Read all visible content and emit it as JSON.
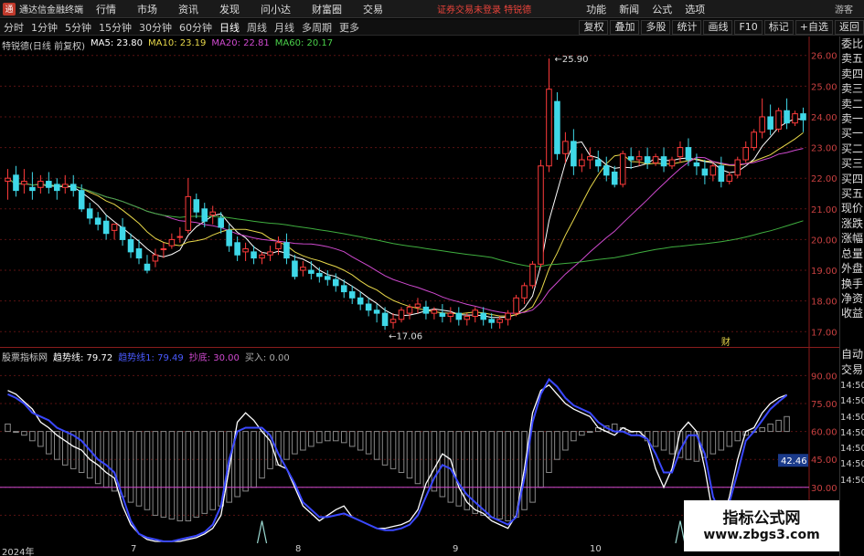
{
  "titlebar": {
    "app_title": "通达信金融终端",
    "menu": [
      "行情",
      "市场",
      "资讯",
      "发现",
      "问小达",
      "财富圈",
      "交易"
    ],
    "notice": "证券交易未登录  特锐德",
    "right_menu": [
      "功能",
      "新闻",
      "公式",
      "选项"
    ],
    "guest": "游客"
  },
  "toolbar": {
    "periods": [
      "分时",
      "1分钟",
      "5分钟",
      "15分钟",
      "30分钟",
      "60分钟",
      "日线",
      "周线",
      "月线",
      "多周期",
      "更多"
    ],
    "active_period": "日线",
    "right_buttons": [
      "复权",
      "叠加",
      "多股",
      "统计",
      "画线",
      "F10",
      "标记",
      "+自选",
      "返回"
    ]
  },
  "main_chart": {
    "stock": "特锐德(日线 前复权)",
    "ma5": "MA5: 23.80",
    "ma10": "MA10: 23.19",
    "ma20": "MA20: 22.81",
    "ma60": "MA60: 20.17",
    "high_label": "25.90",
    "low_label": "17.06",
    "marker_label": "财"
  },
  "indicator": {
    "name": "股票指标网",
    "trend": "趋势线: 79.72",
    "trend2": "趋势线1: 79.49",
    "buy_line": "抄底: 30.00",
    "buy_in": "买入: 0.00",
    "current_value": "42.46",
    "axis_labels": [
      "90.00",
      "75.00",
      "60.00",
      "45.00",
      "30.00",
      "15.00"
    ]
  },
  "x_axis": [
    "2024年",
    "7",
    "8",
    "9",
    "10"
  ],
  "side_panel": [
    "委比",
    "卖五",
    "卖四",
    "卖三",
    "卖二",
    "卖一",
    "买一",
    "买二",
    "买三",
    "买四",
    "买五",
    "现价",
    "涨跌",
    "涨幅",
    "总量",
    "外盘",
    "换手",
    "净资",
    "收益"
  ],
  "side_panel2": [
    "自动",
    "交易"
  ],
  "side_times": [
    "14:50",
    "14:50",
    "14:50",
    "14:50",
    "14:50",
    "14:50",
    "14:50"
  ],
  "watermark": {
    "title": "指标公式网",
    "url": "www.zbgs3.com"
  },
  "chart_data": [
    {
      "type": "line",
      "chart_kind": "candlestick",
      "y_axis_labels": [
        "26.00",
        "25.00",
        "24.00",
        "23.00",
        "22.00",
        "21.00",
        "20.00",
        "19.00",
        "18.00",
        "17.00"
      ],
      "ylim": [
        16.8,
        26.2
      ],
      "x_ticks": [
        "2024年",
        "7",
        "8",
        "9",
        "10"
      ],
      "candles": [
        [
          21.9,
          22.3,
          22.0,
          21.3
        ],
        [
          22.1,
          22.4,
          21.6,
          21.4
        ],
        [
          21.8,
          22.3,
          21.9,
          21.5
        ],
        [
          21.7,
          22.2,
          21.6,
          21.3
        ],
        [
          21.7,
          22.1,
          21.9,
          21.5
        ],
        [
          21.9,
          22.2,
          21.7,
          21.5
        ],
        [
          21.8,
          22.0,
          21.6,
          21.3
        ],
        [
          21.7,
          22.1,
          21.8,
          21.5
        ],
        [
          21.8,
          22.1,
          21.6,
          21.4
        ],
        [
          21.6,
          21.8,
          21.0,
          20.9
        ],
        [
          21.0,
          21.2,
          20.7,
          20.5
        ],
        [
          20.7,
          20.9,
          20.5,
          20.3
        ],
        [
          20.6,
          20.8,
          20.2,
          20.0
        ],
        [
          20.3,
          20.5,
          20.5,
          20.0
        ],
        [
          20.4,
          20.7,
          20.0,
          19.8
        ],
        [
          20.0,
          20.2,
          19.6,
          19.4
        ],
        [
          19.7,
          20.0,
          19.4,
          19.2
        ],
        [
          19.2,
          19.5,
          19.0,
          18.9
        ],
        [
          19.3,
          19.7,
          19.5,
          19.1
        ],
        [
          19.7,
          19.9,
          19.7,
          19.4
        ],
        [
          19.8,
          20.2,
          20.0,
          19.7
        ],
        [
          20.1,
          20.4,
          20.1,
          19.9
        ],
        [
          20.3,
          22.0,
          21.4,
          20.2
        ],
        [
          21.3,
          21.5,
          20.9,
          20.7
        ],
        [
          21.0,
          21.2,
          20.6,
          20.4
        ],
        [
          20.8,
          21.1,
          20.9,
          20.5
        ],
        [
          20.7,
          20.9,
          20.4,
          20.2
        ],
        [
          20.3,
          20.5,
          19.8,
          19.6
        ],
        [
          19.9,
          20.1,
          19.5,
          19.3
        ],
        [
          19.6,
          19.9,
          19.7,
          19.3
        ],
        [
          19.6,
          19.8,
          19.4,
          19.2
        ],
        [
          19.4,
          19.6,
          19.5,
          19.2
        ],
        [
          19.5,
          19.8,
          19.6,
          19.3
        ],
        [
          19.7,
          20.1,
          19.9,
          19.5
        ],
        [
          19.9,
          20.2,
          19.4,
          19.2
        ],
        [
          19.3,
          19.5,
          18.8,
          18.7
        ],
        [
          19.0,
          19.3,
          19.1,
          18.8
        ],
        [
          19.0,
          19.3,
          18.9,
          18.7
        ],
        [
          18.9,
          19.1,
          18.8,
          18.6
        ],
        [
          18.8,
          19.0,
          18.7,
          18.5
        ],
        [
          18.7,
          18.9,
          18.5,
          18.3
        ],
        [
          18.5,
          18.7,
          18.3,
          18.1
        ],
        [
          18.3,
          18.5,
          18.1,
          17.9
        ],
        [
          18.1,
          18.3,
          17.9,
          17.7
        ],
        [
          17.9,
          18.1,
          17.7,
          17.5
        ],
        [
          17.7,
          17.9,
          17.6,
          17.3
        ],
        [
          17.6,
          17.8,
          17.2,
          17.06
        ],
        [
          17.3,
          17.6,
          17.4,
          17.1
        ],
        [
          17.4,
          17.8,
          17.7,
          17.3
        ],
        [
          17.6,
          17.9,
          17.8,
          17.4
        ],
        [
          17.8,
          18.1,
          17.9,
          17.6
        ],
        [
          17.8,
          18.0,
          17.6,
          17.4
        ],
        [
          17.6,
          17.8,
          17.7,
          17.4
        ],
        [
          17.6,
          17.9,
          17.5,
          17.3
        ],
        [
          17.5,
          17.8,
          17.6,
          17.3
        ],
        [
          17.6,
          17.8,
          17.4,
          17.2
        ],
        [
          17.4,
          17.6,
          17.5,
          17.2
        ],
        [
          17.5,
          17.8,
          17.7,
          17.3
        ],
        [
          17.6,
          17.8,
          17.4,
          17.2
        ],
        [
          17.4,
          17.6,
          17.3,
          17.1
        ],
        [
          17.3,
          17.5,
          17.4,
          17.1
        ],
        [
          17.4,
          17.7,
          17.6,
          17.2
        ],
        [
          17.6,
          18.2,
          18.1,
          17.5
        ],
        [
          18.1,
          18.6,
          18.5,
          17.9
        ],
        [
          18.5,
          19.3,
          19.2,
          18.4
        ],
        [
          19.2,
          22.6,
          22.4,
          19.1
        ],
        [
          22.4,
          25.9,
          24.9,
          22.2
        ],
        [
          24.5,
          24.8,
          22.8,
          22.6
        ],
        [
          22.8,
          23.5,
          23.2,
          22.5
        ],
        [
          23.2,
          23.6,
          22.4,
          22.1
        ],
        [
          22.4,
          22.8,
          22.6,
          22.2
        ],
        [
          22.6,
          23.0,
          22.7,
          22.3
        ],
        [
          22.6,
          22.9,
          22.4,
          22.2
        ],
        [
          22.4,
          22.7,
          22.1,
          21.9
        ],
        [
          22.2,
          22.4,
          21.8,
          21.7
        ],
        [
          21.8,
          22.9,
          22.8,
          21.7
        ],
        [
          22.7,
          23.0,
          22.6,
          22.3
        ],
        [
          22.6,
          22.9,
          22.7,
          22.4
        ],
        [
          22.7,
          23.0,
          22.5,
          22.3
        ],
        [
          22.5,
          22.8,
          22.7,
          22.4
        ],
        [
          22.7,
          23.0,
          22.4,
          22.2
        ],
        [
          22.4,
          22.7,
          22.6,
          22.3
        ],
        [
          22.7,
          23.2,
          23.0,
          22.5
        ],
        [
          23.0,
          23.3,
          22.6,
          22.4
        ],
        [
          22.5,
          22.8,
          22.4,
          22.1
        ],
        [
          22.3,
          22.6,
          22.1,
          21.8
        ],
        [
          22.1,
          22.5,
          22.4,
          21.9
        ],
        [
          22.4,
          22.7,
          21.9,
          21.7
        ],
        [
          21.9,
          22.2,
          22.1,
          21.8
        ],
        [
          22.1,
          22.7,
          22.6,
          22.0
        ],
        [
          22.6,
          23.2,
          23.0,
          22.5
        ],
        [
          23.0,
          23.6,
          23.5,
          22.9
        ],
        [
          23.5,
          24.6,
          24.0,
          23.3
        ],
        [
          24.0,
          24.4,
          23.6,
          23.4
        ],
        [
          23.6,
          24.3,
          24.2,
          23.5
        ],
        [
          24.2,
          24.6,
          23.8,
          23.6
        ],
        [
          23.8,
          24.2,
          24.1,
          23.7
        ],
        [
          24.1,
          24.3,
          23.9,
          23.5
        ]
      ]
    },
    {
      "type": "line",
      "y_axis_labels": [
        "90.00",
        "75.00",
        "60.00",
        "45.00",
        "30.00",
        "15.00"
      ],
      "ylim": [
        0,
        100
      ],
      "series": [
        {
          "name": "趋势线",
          "values": [
            82,
            80,
            76,
            72,
            65,
            62,
            58,
            55,
            52,
            50,
            45,
            42,
            38,
            35,
            20,
            10,
            5,
            2,
            1,
            1,
            1,
            1,
            2,
            3,
            5,
            8,
            15,
            40,
            65,
            70,
            66,
            60,
            55,
            42,
            40,
            30,
            20,
            16,
            12,
            15,
            18,
            20,
            14,
            12,
            10,
            8,
            8,
            9,
            10,
            12,
            18,
            32,
            40,
            48,
            45,
            30,
            22,
            18,
            16,
            12,
            10,
            8,
            15,
            40,
            70,
            82,
            85,
            80,
            75,
            72,
            70,
            68,
            62,
            60,
            58,
            62,
            60,
            60,
            56,
            40,
            30,
            40,
            60,
            65,
            60,
            40,
            15,
            10,
            25,
            45,
            60,
            62,
            70,
            75,
            78,
            79.72
          ]
        },
        {
          "name": "趋势线1",
          "values": [
            80,
            78,
            75,
            70,
            68,
            66,
            62,
            60,
            58,
            55,
            50,
            45,
            42,
            38,
            25,
            12,
            5,
            3,
            2,
            1,
            1,
            2,
            3,
            4,
            6,
            10,
            20,
            45,
            60,
            62,
            62,
            62,
            58,
            48,
            40,
            32,
            22,
            18,
            14,
            14,
            15,
            16,
            14,
            12,
            10,
            8,
            7,
            7,
            8,
            10,
            15,
            25,
            35,
            42,
            40,
            32,
            26,
            22,
            18,
            14,
            12,
            10,
            14,
            35,
            65,
            80,
            88,
            84,
            78,
            74,
            72,
            70,
            65,
            62,
            60,
            60,
            58,
            58,
            56,
            48,
            38,
            38,
            50,
            58,
            58,
            48,
            25,
            15,
            22,
            38,
            55,
            60,
            66,
            72,
            76,
            79.49
          ]
        },
        {
          "name": "抄底",
          "values": [
            30
          ]
        }
      ],
      "bars": [
        64,
        60,
        58,
        55,
        52,
        48,
        45,
        42,
        40,
        38,
        35,
        32,
        30,
        28,
        25,
        22,
        20,
        18,
        15,
        14,
        13,
        12,
        12,
        14,
        16,
        18,
        20,
        22,
        25,
        28,
        30,
        35,
        40,
        42,
        45,
        48,
        50,
        52,
        54,
        55,
        55,
        54,
        52,
        50,
        48,
        45,
        42,
        40,
        38,
        35,
        32,
        30,
        28,
        25,
        22,
        20,
        18,
        16,
        15,
        14,
        13,
        12,
        14,
        18,
        22,
        30,
        38,
        45,
        50,
        55,
        58,
        60,
        62,
        63,
        64,
        62,
        60,
        58,
        55,
        52,
        50,
        48,
        46,
        45,
        44,
        46,
        48,
        50,
        52,
        55,
        58,
        60,
        62,
        64,
        66,
        68
      ]
    }
  ]
}
